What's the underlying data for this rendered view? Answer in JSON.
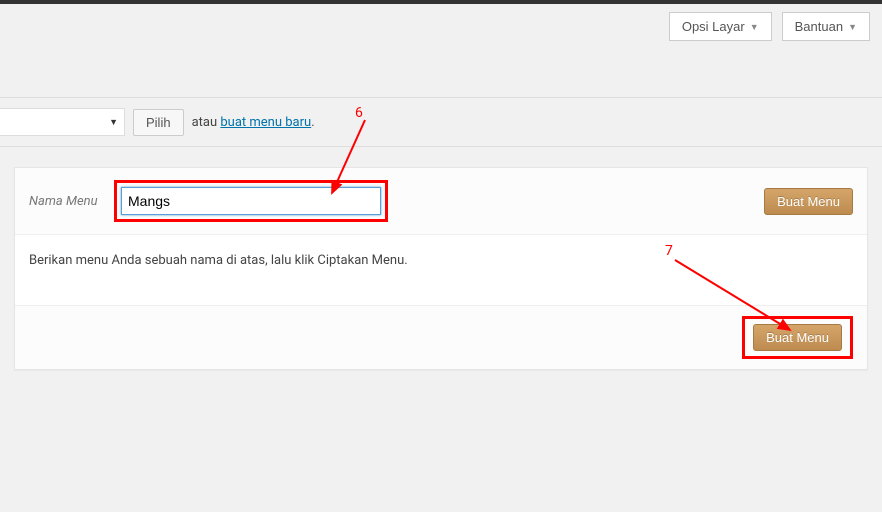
{
  "header": {
    "screen_options": "Opsi Layar",
    "help": "Bantuan"
  },
  "selector": {
    "pilih_label": "Pilih",
    "or_text": "atau ",
    "new_menu_link": "buat menu baru",
    "period": "."
  },
  "menu_form": {
    "label": "Nama Menu",
    "input_value": "Mangs",
    "create_button": "Buat Menu",
    "instruction": "Berikan menu Anda sebuah nama di atas, lalu klik Ciptakan Menu."
  },
  "annotations": {
    "six": "6",
    "seven": "7"
  }
}
